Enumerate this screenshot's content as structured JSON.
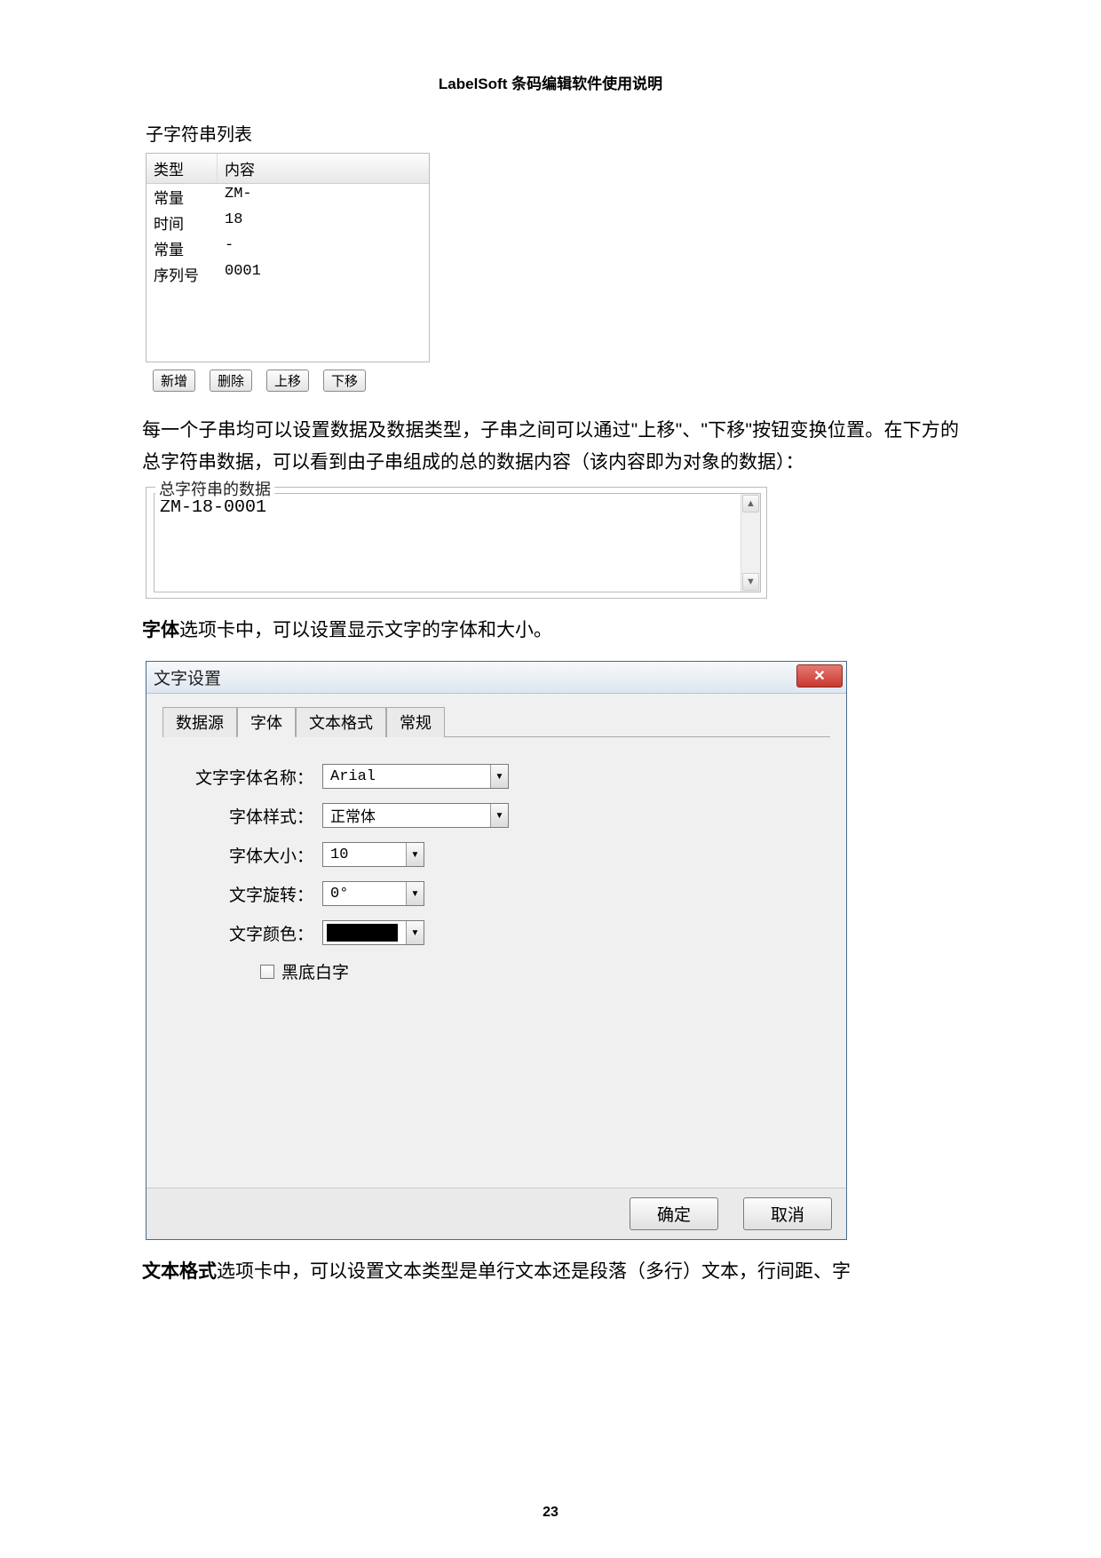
{
  "doc_header": "LabelSoft 条码编辑软件使用说明",
  "substring_section_label": "子字符串列表",
  "substring_table": {
    "headers": {
      "type": "类型",
      "content": "内容"
    },
    "rows": [
      {
        "type": "常量",
        "content": "ZM-"
      },
      {
        "type": "时间",
        "content": "18"
      },
      {
        "type": "常量",
        "content": "-"
      },
      {
        "type": "序列号",
        "content": "0001"
      }
    ],
    "buttons": {
      "add": "新增",
      "del": "删除",
      "up": "上移",
      "down": "下移"
    }
  },
  "paragraph1": "每一个子串均可以设置数据及数据类型，子串之间可以通过\"上移\"、\"下移\"按钮变换位置。在下方的总字符串数据，可以看到由子串组成的总的数据内容（该内容即为对象的数据）：",
  "total_fieldset": {
    "legend": "总字符串的数据",
    "value": "ZM-18-0001"
  },
  "paragraph2_bold": "字体",
  "paragraph2_rest": "选项卡中，可以设置显示文字的字体和大小。",
  "dialog": {
    "title": "文字设置",
    "tabs": {
      "t1": "数据源",
      "t2": "字体",
      "t3": "文本格式",
      "t4": "常规"
    },
    "fields": {
      "font_name_label": "文字字体名称：",
      "font_name_value": "Arial",
      "font_style_label": "字体样式：",
      "font_style_value": "正常体",
      "font_size_label": "字体大小：",
      "font_size_value": "10",
      "rotate_label": "文字旋转：",
      "rotate_value": "0°",
      "color_label": "文字颜色：",
      "inverse_label": "黑底白字"
    },
    "footer": {
      "ok": "确定",
      "cancel": "取消"
    }
  },
  "paragraph3_bold": "文本格式",
  "paragraph3_rest": "选项卡中，可以设置文本类型是单行文本还是段落（多行）文本，行间距、字",
  "page_number": "23"
}
